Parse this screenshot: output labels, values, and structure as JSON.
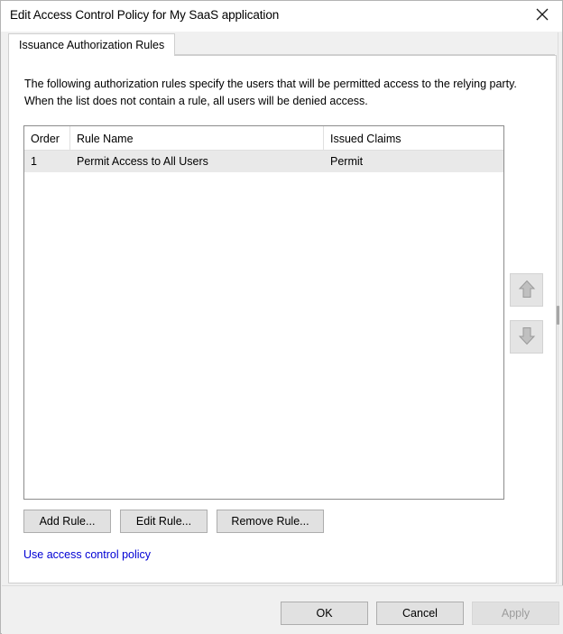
{
  "window": {
    "title": "Edit Access Control Policy for My SaaS application",
    "close_icon": "close-icon"
  },
  "tabs": [
    {
      "label": "Issuance Authorization Rules",
      "selected": true
    }
  ],
  "panel": {
    "description": "The following authorization rules specify the users that will be permitted access to the relying party. When the list does not contain a rule, all users will be denied access."
  },
  "rules_list": {
    "columns": [
      {
        "key": "order",
        "label": "Order"
      },
      {
        "key": "rule_name",
        "label": "Rule Name"
      },
      {
        "key": "issued_claims",
        "label": "Issued Claims"
      }
    ],
    "rows": [
      {
        "order": "1",
        "rule_name": "Permit Access to All Users",
        "issued_claims": "Permit",
        "selected": true
      }
    ]
  },
  "order_buttons": {
    "move_up": {
      "icon": "arrow-up-icon",
      "enabled": false
    },
    "move_down": {
      "icon": "arrow-down-icon",
      "enabled": false
    }
  },
  "rule_actions": {
    "add": "Add Rule...",
    "edit": "Edit Rule...",
    "remove": "Remove Rule..."
  },
  "links": {
    "use_access_control_policy": "Use access control policy"
  },
  "footer": {
    "ok": "OK",
    "cancel": "Cancel",
    "apply": "Apply",
    "apply_enabled": false
  },
  "colors": {
    "link": "#0000d4",
    "selection_row": "#e9e9e9",
    "dialog_background": "#f0f0f0",
    "panel_background": "#ffffff",
    "disabled_text": "#9c9c9c"
  }
}
